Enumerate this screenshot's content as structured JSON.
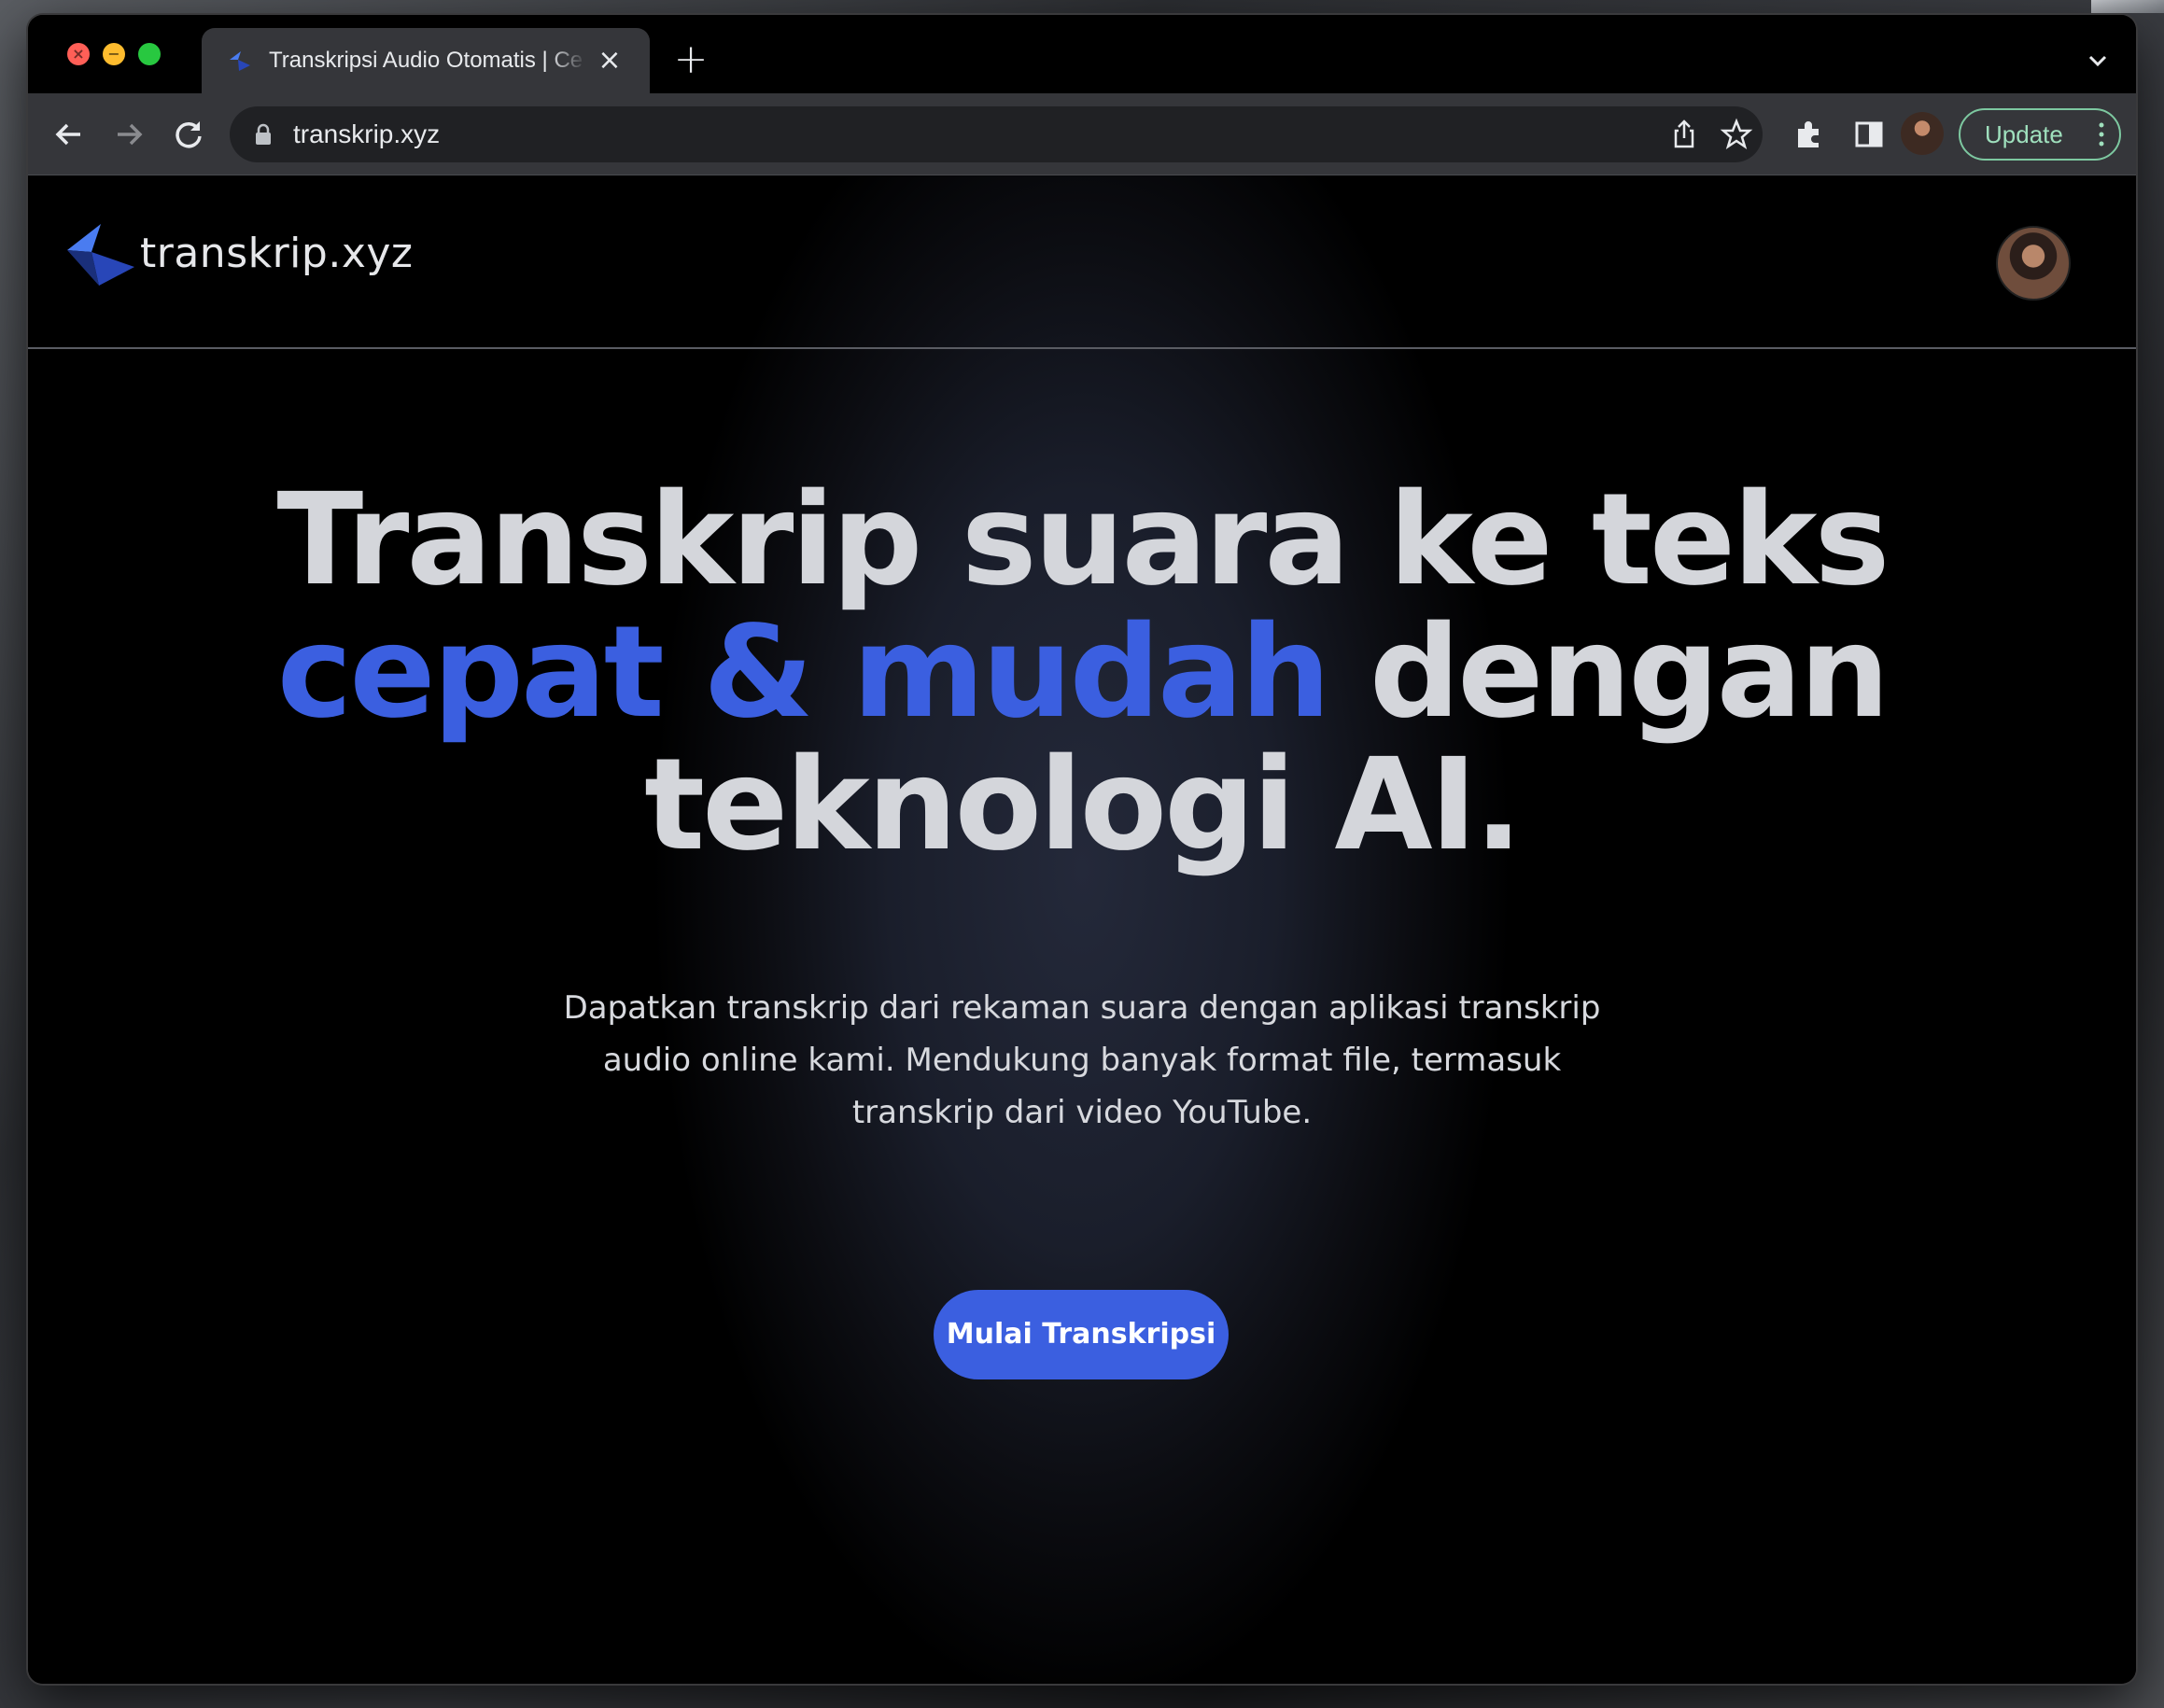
{
  "browser": {
    "tab_title": "Transkripsi Audio Otomatis | Ce",
    "tab_close": "×",
    "new_tab": "+",
    "url": "transkrip.xyz",
    "update_label": "Update"
  },
  "site": {
    "logo_text": "transkrip.xyz",
    "hero": {
      "line1": "Transkrip suara ke teks",
      "line2_accent": "cepat & mudah",
      "line2_rest": " dengan",
      "line3": "teknologi AI.",
      "subtitle": "Dapatkan transkrip dari rekaman suara dengan aplikasi transkrip audio online kami. Mendukung banyak format file, termasuk transkrip dari video YouTube.",
      "cta_label": "Mulai Transkripsi"
    }
  },
  "colors": {
    "accent": "#3b5fe0",
    "hero_text": "#d4d6db",
    "update_border": "#7dc8a0"
  },
  "icons": [
    "back-arrow-icon",
    "forward-arrow-icon",
    "reload-icon",
    "lock-icon",
    "share-icon",
    "star-icon",
    "extensions-icon",
    "side-panel-icon",
    "kebab-menu-icon",
    "chevron-down-icon",
    "close-icon"
  ]
}
